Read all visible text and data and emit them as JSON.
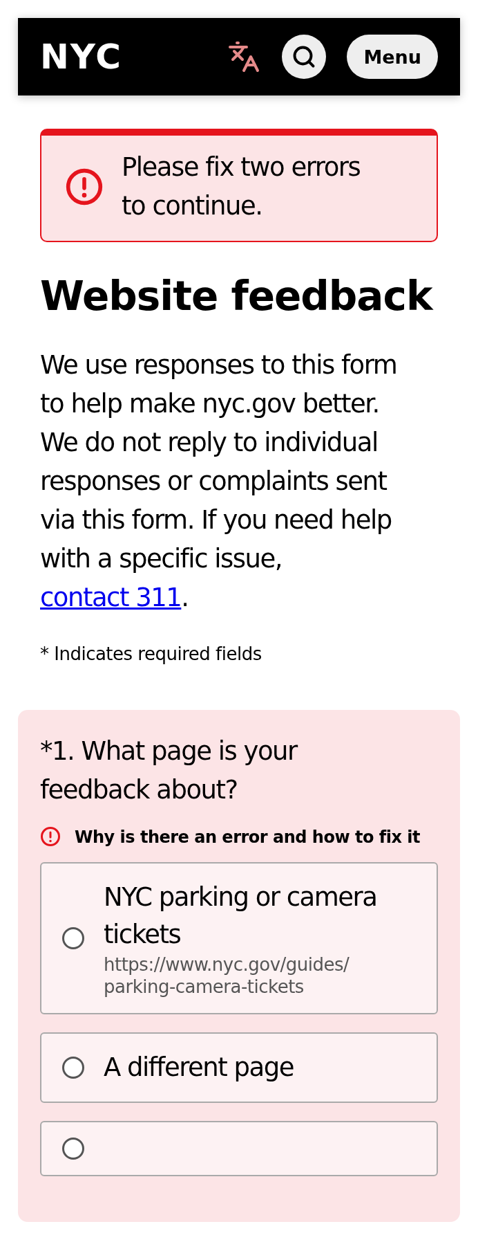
{
  "header": {
    "logo": "NYC",
    "menu_button": "Menu"
  },
  "error_alert": {
    "message": "Please fix two errors to continue."
  },
  "title": "Website feedback",
  "intro": {
    "text": "We use responses to this form to help make nyc.gov better. We do not reply to individual responses or complaints sent via this form. If you need help with a specific issue, ",
    "link": "contact 311",
    "after": "."
  },
  "required_note": "* Indicates required fields",
  "question": {
    "label": "*1. What page is your feedback about?",
    "error": "Why is there an error and how to fix it",
    "options": [
      {
        "label": "NYC parking or camera tickets",
        "url": "https://www.nyc.gov/guides/ parking-camera-tickets",
        "selected": false
      },
      {
        "label": "A different page",
        "selected": false
      },
      {
        "selected": false
      }
    ]
  }
}
